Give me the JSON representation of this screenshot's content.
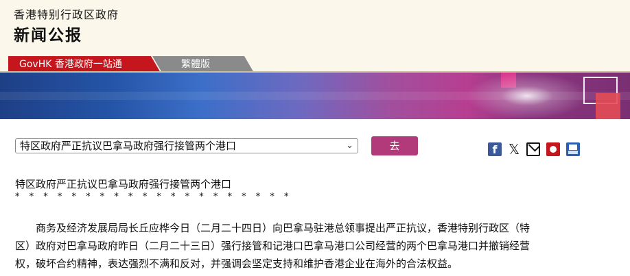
{
  "masthead": {
    "government": "香港特别行政区政府",
    "section": "新闻公报"
  },
  "tabs": [
    {
      "label": "GovHK 香港政府一站通",
      "color": "#c4161c"
    },
    {
      "label": "繁體版",
      "color": "#8a8a8a"
    }
  ],
  "headline_selector": {
    "selected": "特区政府严正抗议巴拿马政府强行接管两个港口",
    "go_label": "去"
  },
  "share_icons": [
    "facebook-icon",
    "x-icon",
    "mail-icon",
    "bookmark-icon",
    "print-icon"
  ],
  "article": {
    "title": "特区政府严正抗议巴拿马政府强行接管两个港口",
    "separator": "* * * * * * * * * * * * * * * * * * * *",
    "body_lines": [
      "　　商务及经济发展局局长丘应桦今日（二月二十四日）向巴拿马驻港总领事提出严正抗议，香港特别行政区（特",
      "区）政府对巴拿马政府昨日（二月二十三日）强行接管和记港口巴拿马港口公司经营的两个巴拿马港口并撤销经营",
      "权，破坏合约精神，表达强烈不满和反对，并强调会坚定支持和维护香港企业在海外的合法权益。"
    ]
  },
  "colors": {
    "accent": "#b33a7a",
    "govhk_red": "#c4161c",
    "masthead_bg": "#fbf8eb"
  }
}
